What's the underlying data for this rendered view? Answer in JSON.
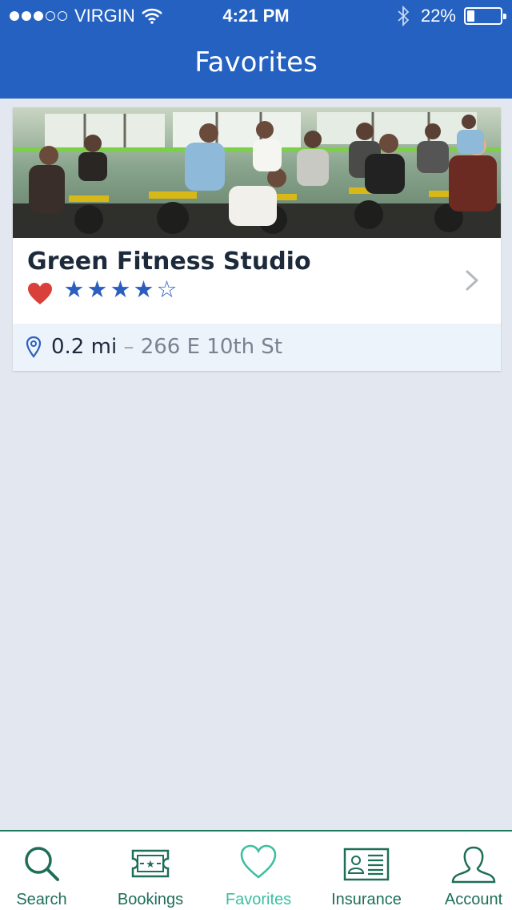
{
  "status_bar": {
    "carrier": "VIRGIN",
    "time": "4:21 PM",
    "battery": "22%",
    "battery_level": 0.22,
    "signal_bars": 3
  },
  "header": {
    "title": "Favorites"
  },
  "favorites": [
    {
      "name": "Green Fitness Studio",
      "favorited": true,
      "rating": 4,
      "rating_max": 5,
      "distance": "0.2 mi",
      "separator": "–",
      "address": "266 E 10th St",
      "photo_icon": "spin-class-photo"
    }
  ],
  "tabs": [
    {
      "label": "Search",
      "icon": "search-icon",
      "active": false
    },
    {
      "label": "Bookings",
      "icon": "ticket-icon",
      "active": false
    },
    {
      "label": "Favorites",
      "icon": "heart-outline-icon",
      "active": true
    },
    {
      "label": "Insurance",
      "icon": "id-card-icon",
      "active": false
    },
    {
      "label": "Account",
      "icon": "user-icon",
      "active": false
    }
  ],
  "colors": {
    "header_blue": "#2461c1",
    "star_blue": "#2a5fc0",
    "heart_red": "#d9403a",
    "tab_green": "#1f6e58",
    "tab_active": "#3cc0a0"
  }
}
